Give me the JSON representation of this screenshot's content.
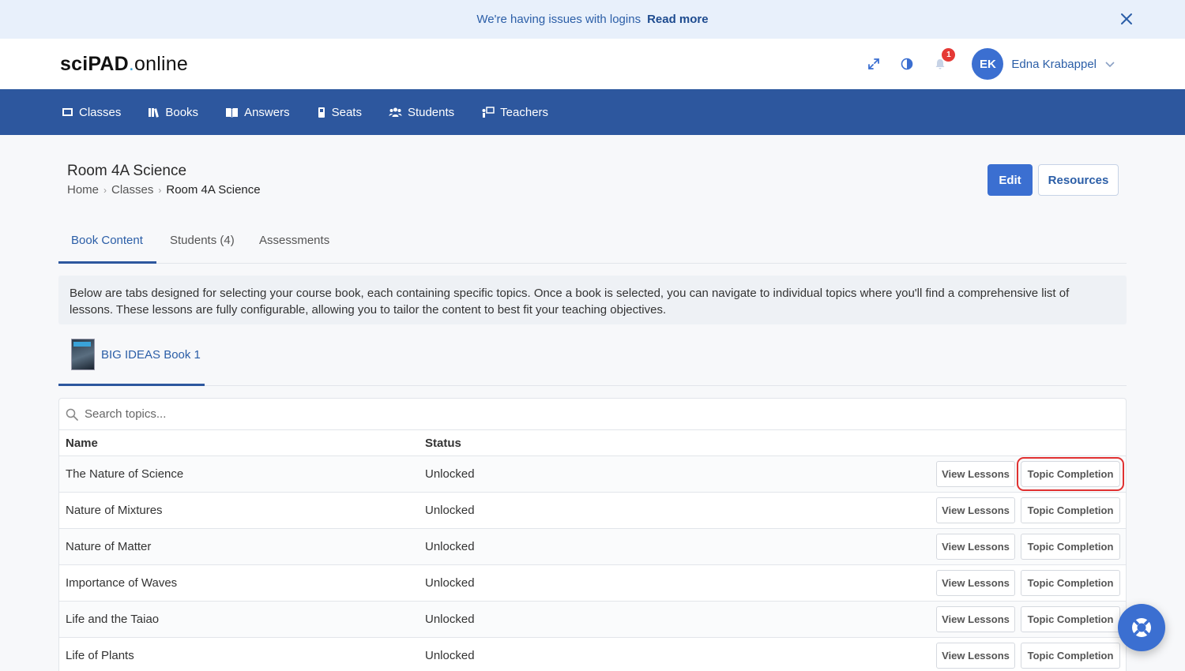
{
  "banner": {
    "message": "We're having issues with logins",
    "link": "Read more"
  },
  "header": {
    "logo_bold": "sciPAD",
    "logo_dot": ".",
    "logo_rest": "online",
    "notifications_count": "1",
    "user_initials": "EK",
    "user_name": "Edna Krabappel"
  },
  "nav": {
    "items": [
      {
        "label": "Classes",
        "icon": "classes-icon"
      },
      {
        "label": "Books",
        "icon": "books-icon"
      },
      {
        "label": "Answers",
        "icon": "answers-icon"
      },
      {
        "label": "Seats",
        "icon": "seats-icon"
      },
      {
        "label": "Students",
        "icon": "students-icon"
      },
      {
        "label": "Teachers",
        "icon": "teachers-icon"
      }
    ]
  },
  "page": {
    "title": "Room 4A Science",
    "breadcrumb": [
      "Home",
      "Classes",
      "Room 4A Science"
    ],
    "edit_label": "Edit",
    "resources_label": "Resources"
  },
  "tabs": [
    "Book Content",
    "Students (4)",
    "Assessments"
  ],
  "info_text": "Below are tabs designed for selecting your course book, each containing specific topics. Once a book is selected, you can navigate to individual topics where you'll find a comprehensive list of lessons. These lessons are fully configurable, allowing you to tailor the content to best fit your teaching objectives.",
  "book": {
    "label": "BIG IDEAS Book 1"
  },
  "table": {
    "search_placeholder": "Search topics...",
    "headers": {
      "name": "Name",
      "status": "Status"
    },
    "view_label": "View Lessons",
    "topic_label": "Topic Completion",
    "rows": [
      {
        "name": "The Nature of Science",
        "status": "Unlocked"
      },
      {
        "name": "Nature of Mixtures",
        "status": "Unlocked"
      },
      {
        "name": "Nature of Matter",
        "status": "Unlocked"
      },
      {
        "name": "Importance of Waves",
        "status": "Unlocked"
      },
      {
        "name": "Life and the Taiao",
        "status": "Unlocked"
      },
      {
        "name": "Life of Plants",
        "status": "Unlocked"
      }
    ]
  },
  "colors": {
    "primary": "#3b6fd1",
    "nav_bg": "#2d579e",
    "banner_bg": "#e8f0fb",
    "highlight": "#e03131"
  }
}
